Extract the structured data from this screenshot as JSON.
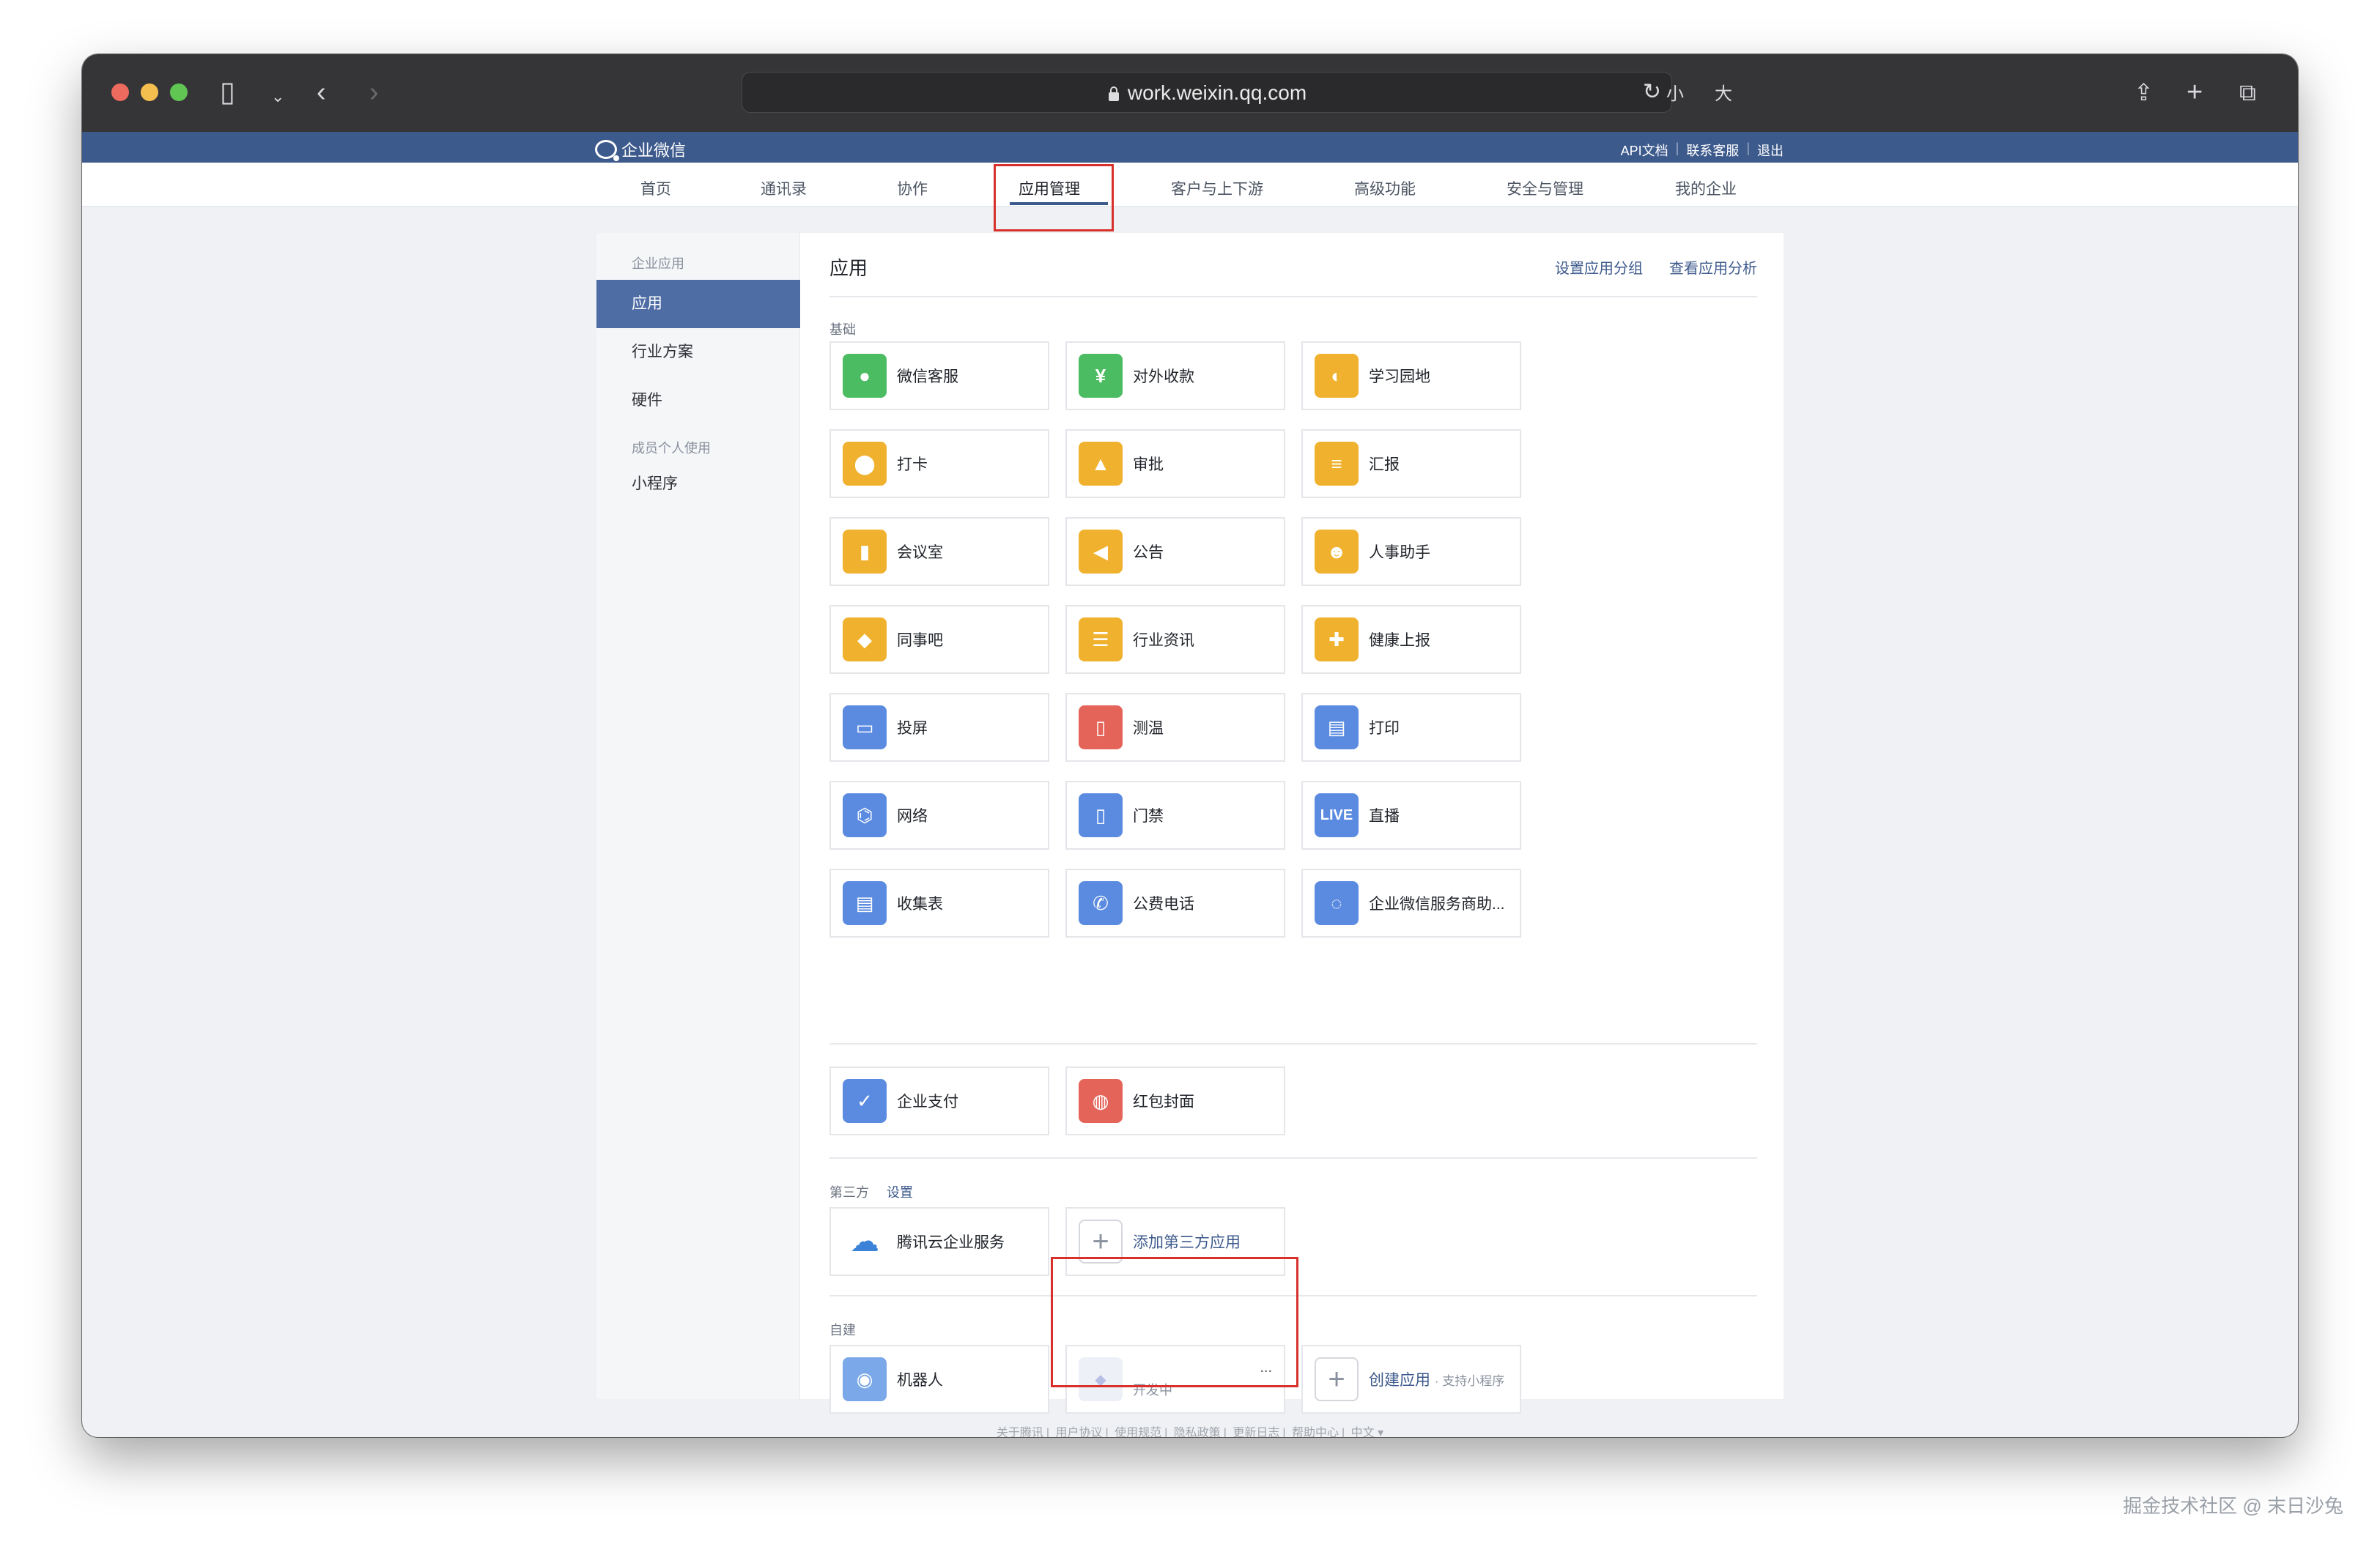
{
  "browser": {
    "url": "work.weixin.qq.com",
    "text_small": "小",
    "text_large": "大"
  },
  "topbar": {
    "brand": "企业微信",
    "links": [
      "API文档",
      "联系客服",
      "退出"
    ]
  },
  "nav": {
    "items": [
      "首页",
      "通讯录",
      "协作",
      "应用管理",
      "客户与上下游",
      "高级功能",
      "安全与管理",
      "我的企业"
    ]
  },
  "sidebar": {
    "group1": "企业应用",
    "items": [
      "应用",
      "行业方案",
      "硬件"
    ],
    "group2": "成员个人使用",
    "items2": [
      "小程序"
    ]
  },
  "main": {
    "title": "应用",
    "links": [
      "设置应用分组",
      "查看应用分析"
    ],
    "basic_label": "基础",
    "basic_apps": [
      {
        "name": "微信客服",
        "icon": "chat-icon",
        "color": "#4cbc62"
      },
      {
        "name": "对外收款",
        "icon": "yuan-icon",
        "color": "#4cbc62"
      },
      {
        "name": "学习园地",
        "icon": "planet-icon",
        "color": "#f0b22e"
      },
      {
        "name": "打卡",
        "icon": "location-pin-icon",
        "color": "#f0b22e"
      },
      {
        "name": "审批",
        "icon": "stamp-icon",
        "color": "#f0b22e"
      },
      {
        "name": "汇报",
        "icon": "report-icon",
        "color": "#f0b22e"
      },
      {
        "name": "会议室",
        "icon": "door-icon",
        "color": "#f0b22e"
      },
      {
        "name": "公告",
        "icon": "megaphone-icon",
        "color": "#f0b22e"
      },
      {
        "name": "人事助手",
        "icon": "person-icon",
        "color": "#f0b22e"
      },
      {
        "name": "同事吧",
        "icon": "network-icon",
        "color": "#f0b22e"
      },
      {
        "name": "行业资讯",
        "icon": "document-icon",
        "color": "#f0b22e"
      },
      {
        "name": "健康上报",
        "icon": "medical-icon",
        "color": "#f0b22e"
      },
      {
        "name": "投屏",
        "icon": "screen-cast-icon",
        "color": "#5b8be0"
      },
      {
        "name": "测温",
        "icon": "thermometer-icon",
        "color": "#e5645a"
      },
      {
        "name": "打印",
        "icon": "printer-icon",
        "color": "#5b8be0"
      },
      {
        "name": "网络",
        "icon": "router-icon",
        "color": "#5b8be0"
      },
      {
        "name": "门禁",
        "icon": "door-access-icon",
        "color": "#5b8be0"
      },
      {
        "name": "直播",
        "icon": "live-icon",
        "color": "#5b8be0",
        "badge": "LIVE"
      },
      {
        "name": "收集表",
        "icon": "form-icon",
        "color": "#5b8be0"
      },
      {
        "name": "公费电话",
        "icon": "phone-icon",
        "color": "#5b8be0"
      },
      {
        "name": "企业微信服务商助...",
        "icon": "wecom-bubble-icon",
        "color": "#5b8be0"
      }
    ],
    "pay_apps": [
      {
        "name": "企业支付",
        "icon": "payment-icon",
        "color": "#5b8be0"
      },
      {
        "name": "红包封面",
        "icon": "red-envelope-icon",
        "color": "#e5645a"
      }
    ],
    "third_party_label": "第三方",
    "third_party_link": "设置",
    "third_party_apps": [
      {
        "name": "腾讯云企业服务",
        "icon": "cloud-icon"
      },
      {
        "name": "添加第三方应用",
        "icon": "plus-icon"
      }
    ],
    "custom_label": "自建",
    "custom_apps": {
      "robot": "机器人",
      "dev_status": "开发中",
      "dev_more": "...",
      "create": "创建应用",
      "create_hint": "· 支持小程序"
    }
  },
  "footer": {
    "links": [
      "关于腾讯",
      "用户协议",
      "使用规范",
      "隐私政策",
      "更新日志",
      "帮助中心",
      "中文 ▾"
    ]
  },
  "watermark": "掘金技术社区 @ 末日沙兔"
}
